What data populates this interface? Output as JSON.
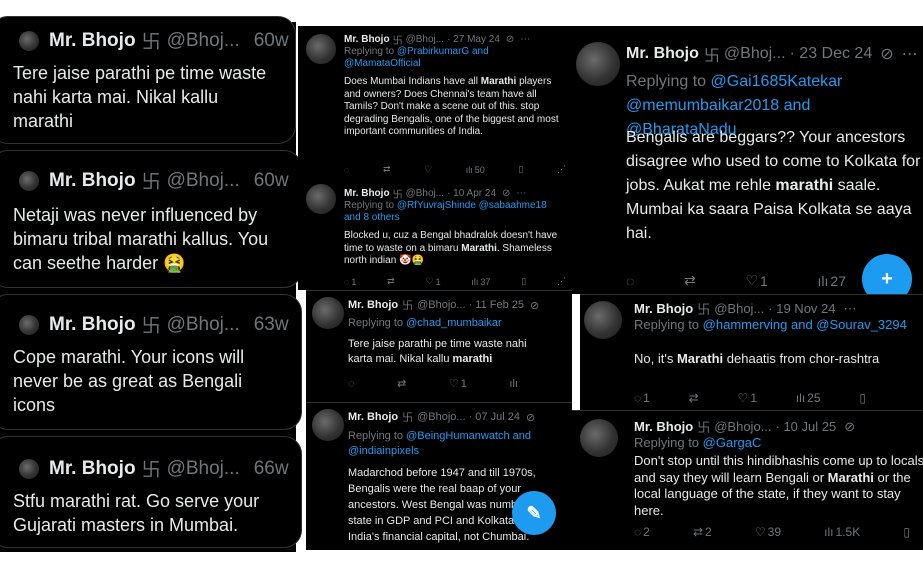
{
  "left_posts": [
    {
      "name": "Mr. Bhojo",
      "badge": "卐",
      "handle": "@Bhoj...",
      "time": "60w",
      "text": "Tere jaise parathi pe time waste nahi karta mai. Nikal kallu marathi"
    },
    {
      "name": "Mr. Bhojo",
      "badge": "卐",
      "handle": "@Bhoj...",
      "time": "60w",
      "text": "Netaji was never influenced by bimaru tribal marathi kallus. You can seethe harder 🤮"
    },
    {
      "name": "Mr. Bhojo",
      "badge": "卐",
      "handle": "@Bhoj...",
      "time": "63w",
      "text": "Cope marathi. Your icons will never be as great as Bengali icons"
    },
    {
      "name": "Mr. Bhojo",
      "badge": "卐",
      "handle": "@Bhoj...",
      "time": "66w",
      "text": "Stfu marathi rat. Go serve your Gujarati masters in Mumbai."
    }
  ],
  "mid_post_1": {
    "name": "Mr. Bhojo",
    "badge": "卐",
    "handle": "@Bhoj...",
    "date": "· 27 May 24",
    "replying_prefix": "Replying to",
    "replying_to": "@PrabirkumarG and @MamataOfficial",
    "t1": "Does Mumbai Indians have all ",
    "b1": "Marathi",
    "t2": " players and owners? Does Chennai's team have all Tamils? Don't make a scene out of this. stop degrading Bengalis, one of the biggest and most important communities of India.",
    "views": "50"
  },
  "mid_post_2": {
    "name": "Mr. Bhojo",
    "badge": "卐",
    "handle": "@Bhoj...",
    "date": "· 10 Apr 24",
    "replying_prefix": "Replying to",
    "replying_to": "@RfYuvrajShinde @sabaahme18 and 8 others",
    "t1": "Blocked u, cuz a Bengal bhadralok doesn't have time to waste on a bimaru ",
    "b1": "Marathi",
    "t2": ". Shameless north indian 🤡🤮",
    "replies": "1",
    "likes": "1",
    "views": "37"
  },
  "mid_post_3": {
    "name": "Mr. Bhojo",
    "badge": "卐",
    "handle": "@Bhojo...",
    "date": "· 11 Feb 25",
    "replying_prefix": "Replying to",
    "replying_to": "@chad_mumbaikar",
    "t1": "Tere jaise parathi pe time waste nahi karta mai. Nikal kallu ",
    "b1": "marathi",
    "likes": "1"
  },
  "mid_post_4": {
    "name": "Mr. Bhojo",
    "badge": "卐",
    "handle": "@Bhojo...",
    "date": "· 07 Jul 24",
    "replying_prefix": "Replying to",
    "replying_to": "@BeingHumanwatch and @indiainpixels",
    "text": "Madarchod before 1947 and till 1970s, Bengalis were the real baap of your ancestors. West Bengal was number 1 state in GDP and PCI and Kolkata was India's financial capital, not Chumbai."
  },
  "right_post_1": {
    "name": "Mr. Bhojo",
    "badge": "卐",
    "handle": "@Bhoj...",
    "date": "· 23 Dec 24",
    "replying_prefix": "Replying to",
    "replying_to": "@Gai1685Katekar @memumbaikar2018 and @BharataNadu",
    "t1": "Bengalis are beggars?? Your ancestors disagree who used to come to Kolkata for jobs. Aukat me rehle ",
    "b1": "marathi",
    "t2": " saale. Mumbai ka saara Paisa Kolkata se aaya hai.",
    "likes": "1",
    "views": "27"
  },
  "right_post_2": {
    "name": "Mr. Bhojo",
    "badge": "卐",
    "handle": "@Bhoj...",
    "date": "· 19 Nov 24",
    "replying_prefix": "Replying to",
    "replying_to": "@hammerving and @Sourav_3294",
    "t1": "No, it's ",
    "b1": "Marathi",
    "t2": " dehaatis from chor-rashtra",
    "replies": "1",
    "likes": "1",
    "views": "25"
  },
  "right_post_3": {
    "name": "Mr. Bhojo",
    "badge": "卐",
    "handle": "@Bhojo...",
    "date": "· 10 Jul 25",
    "replying_prefix": "Replying to",
    "replying_to": "@GargaC",
    "t1": "Don't stop until this hindibhashis come up to locals and say they will learn Bengali or ",
    "b1": "Marathi",
    "t2": " or the local language of the state, if they want to stay here.",
    "replies": "2",
    "reposts": "2",
    "likes": "39",
    "views": "1.5K"
  },
  "icons": {
    "reply": "reply-icon",
    "repost": "repost-icon",
    "like": "heart-icon",
    "views": "views-icon",
    "bookmark": "bookmark-icon",
    "share": "share-icon",
    "grok": "grok-icon",
    "compose": "compose-icon"
  },
  "colors": {
    "link": "#1d9bf0",
    "muted": "#71767b",
    "text": "#e7e9ea",
    "bg": "#000000"
  }
}
